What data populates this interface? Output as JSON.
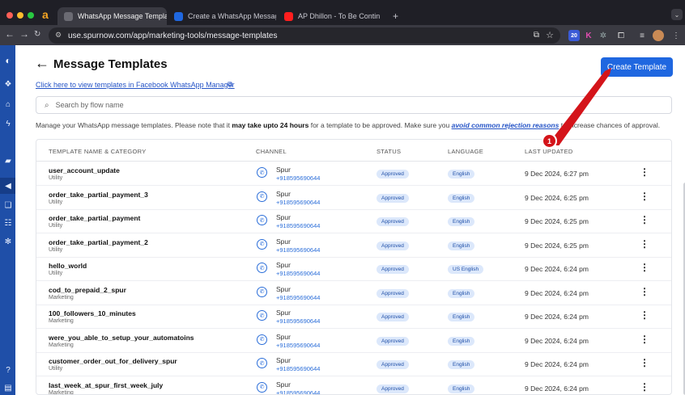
{
  "browser": {
    "tabs": [
      {
        "label": "WhatsApp Message Templat",
        "active": true
      },
      {
        "label": "Create a WhatsApp Message",
        "active": false
      },
      {
        "label": "AP Dhillon - To Be Contin",
        "active": false
      }
    ],
    "new_tab": "+",
    "url": "use.spurnow.com/app/marketing-tools/message-templates",
    "extension_badge": "20"
  },
  "page": {
    "title": "Message Templates",
    "fb_link": "Click here to view templates in Facebook WhatsApp Manager",
    "create_button": "Create Template",
    "search_placeholder": "Search by flow name",
    "info": {
      "part1": "Manage your WhatsApp message templates. Please note that it ",
      "bold": "may take upto 24 hours",
      "part2": " for a template to be approved. Make sure you ",
      "link": "avoid common rejection reasons",
      "part3": " to increase chances of approval."
    },
    "annotation_number": "1"
  },
  "table": {
    "headers": {
      "name": "TEMPLATE NAME & CATEGORY",
      "channel": "CHANNEL",
      "status": "STATUS",
      "language": "LANGUAGE",
      "updated": "LAST UPDATED"
    },
    "rows": [
      {
        "name": "user_account_update",
        "category": "Utility",
        "channel": "Spur",
        "number": "+918595690644",
        "status": "Approved",
        "language": "English",
        "updated": "9 Dec 2024, 6:27 pm"
      },
      {
        "name": "order_take_partial_payment_3",
        "category": "Utility",
        "channel": "Spur",
        "number": "+918595690644",
        "status": "Approved",
        "language": "English",
        "updated": "9 Dec 2024, 6:25 pm"
      },
      {
        "name": "order_take_partial_payment",
        "category": "Utility",
        "channel": "Spur",
        "number": "+918595690644",
        "status": "Approved",
        "language": "English",
        "updated": "9 Dec 2024, 6:25 pm"
      },
      {
        "name": "order_take_partial_payment_2",
        "category": "Utility",
        "channel": "Spur",
        "number": "+918595690644",
        "status": "Approved",
        "language": "English",
        "updated": "9 Dec 2024, 6:25 pm"
      },
      {
        "name": "hello_world",
        "category": "Utility",
        "channel": "Spur",
        "number": "+918595690644",
        "status": "Approved",
        "language": "US English",
        "updated": "9 Dec 2024, 6:24 pm"
      },
      {
        "name": "cod_to_prepaid_2_spur",
        "category": "Marketing",
        "channel": "Spur",
        "number": "+918595690644",
        "status": "Approved",
        "language": "English",
        "updated": "9 Dec 2024, 6:24 pm"
      },
      {
        "name": "100_followers_10_minutes",
        "category": "Marketing",
        "channel": "Spur",
        "number": "+918595690644",
        "status": "Approved",
        "language": "English",
        "updated": "9 Dec 2024, 6:24 pm"
      },
      {
        "name": "were_you_able_to_setup_your_automatoins",
        "category": "Marketing",
        "channel": "Spur",
        "number": "+918595690644",
        "status": "Approved",
        "language": "English",
        "updated": "9 Dec 2024, 6:24 pm"
      },
      {
        "name": "customer_order_out_for_delivery_spur",
        "category": "Utility",
        "channel": "Spur",
        "number": "+918595690644",
        "status": "Approved",
        "language": "English",
        "updated": "9 Dec 2024, 6:24 pm"
      },
      {
        "name": "last_week_at_spur_first_week_july",
        "category": "Marketing",
        "channel": "Spur",
        "number": "+918595690644",
        "status": "Approved",
        "language": "English",
        "updated": "9 Dec 2024, 6:24 pm"
      }
    ]
  },
  "colors": {
    "sidebar": "#1f4fa8",
    "primary_button": "#1f67e0",
    "annotation": "#d4141a"
  }
}
